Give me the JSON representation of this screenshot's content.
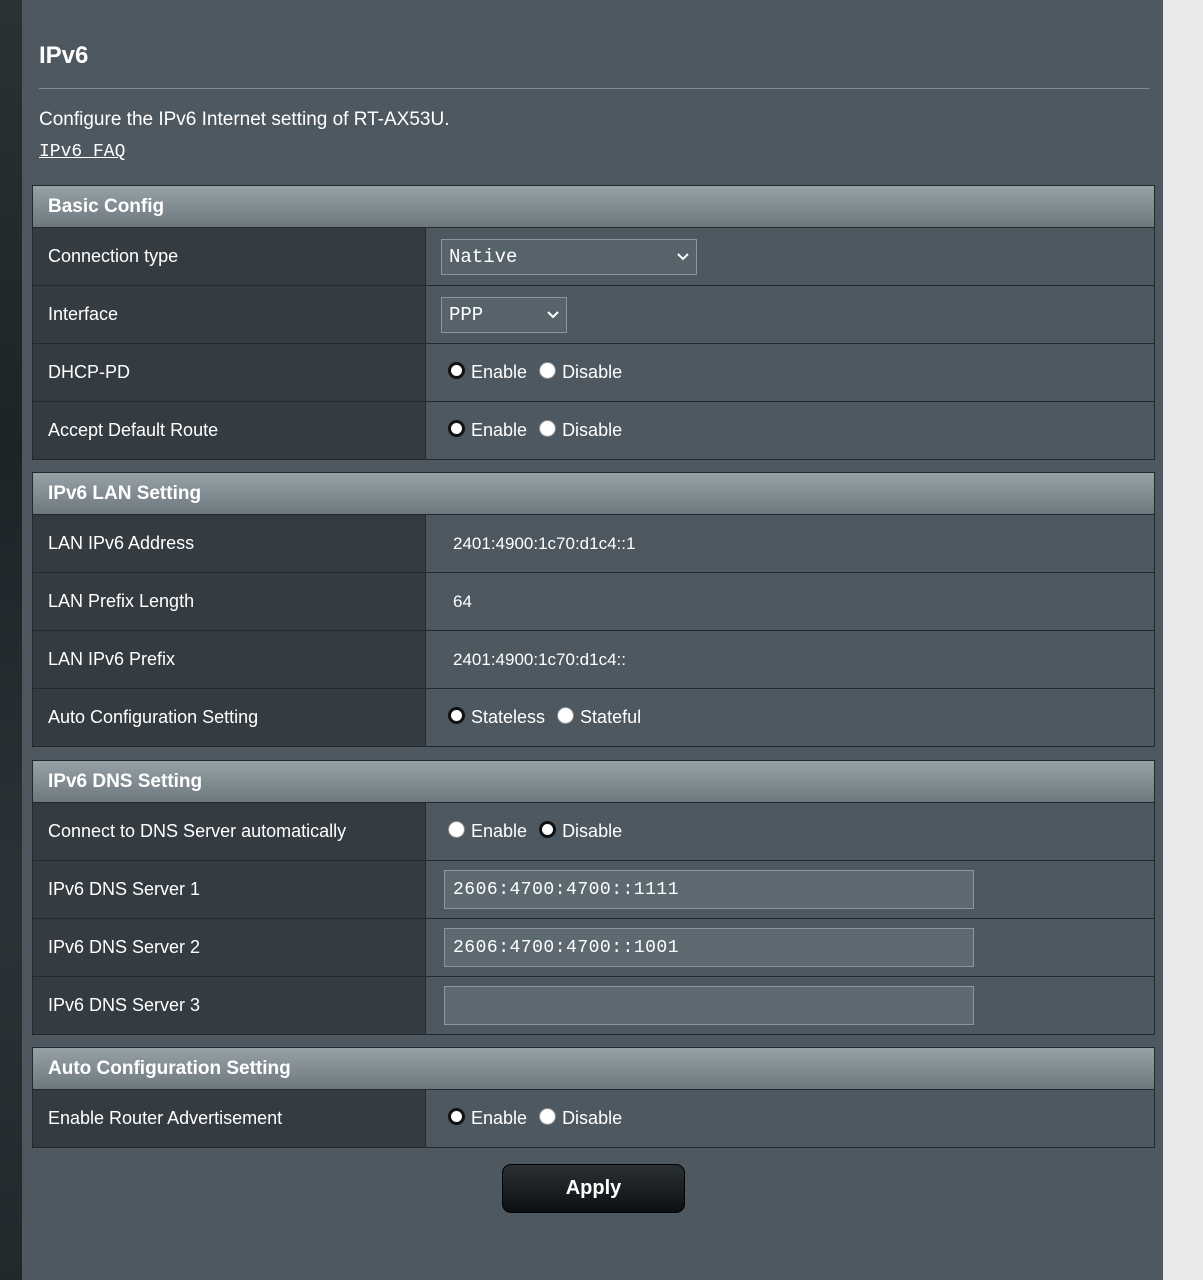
{
  "page": {
    "title": "IPv6",
    "description": "Configure the IPv6 Internet setting of RT-AX53U.",
    "faq_link": "IPv6_FAQ"
  },
  "basic_config": {
    "header": "Basic Config",
    "connection_type": {
      "label": "Connection type",
      "value": "Native"
    },
    "interface": {
      "label": "Interface",
      "value": "PPP"
    },
    "dhcp_pd": {
      "label": "DHCP-PD",
      "options": [
        "Enable",
        "Disable"
      ],
      "selected": "Enable"
    },
    "accept_default_route": {
      "label": "Accept Default Route",
      "options": [
        "Enable",
        "Disable"
      ],
      "selected": "Enable"
    }
  },
  "lan_setting": {
    "header": "IPv6 LAN Setting",
    "lan_ipv6_address": {
      "label": "LAN IPv6 Address",
      "value": "2401:4900:1c70:d1c4::1"
    },
    "lan_prefix_length": {
      "label": "LAN Prefix Length",
      "value": "64"
    },
    "lan_ipv6_prefix": {
      "label": "LAN IPv6 Prefix",
      "value": "2401:4900:1c70:d1c4::"
    },
    "auto_config": {
      "label": "Auto Configuration Setting",
      "options": [
        "Stateless",
        "Stateful"
      ],
      "selected": "Stateless"
    }
  },
  "dns_setting": {
    "header": "IPv6 DNS Setting",
    "connect_auto": {
      "label": "Connect to DNS Server automatically",
      "options": [
        "Enable",
        "Disable"
      ],
      "selected": "Disable"
    },
    "dns1": {
      "label": "IPv6 DNS Server 1",
      "value": "2606:4700:4700::1111"
    },
    "dns2": {
      "label": "IPv6 DNS Server 2",
      "value": "2606:4700:4700::1001"
    },
    "dns3": {
      "label": "IPv6 DNS Server 3",
      "value": ""
    }
  },
  "auto_configuration": {
    "header": "Auto Configuration Setting",
    "router_advertisement": {
      "label": "Enable Router Advertisement",
      "options": [
        "Enable",
        "Disable"
      ],
      "selected": "Enable"
    }
  },
  "apply_label": "Apply"
}
